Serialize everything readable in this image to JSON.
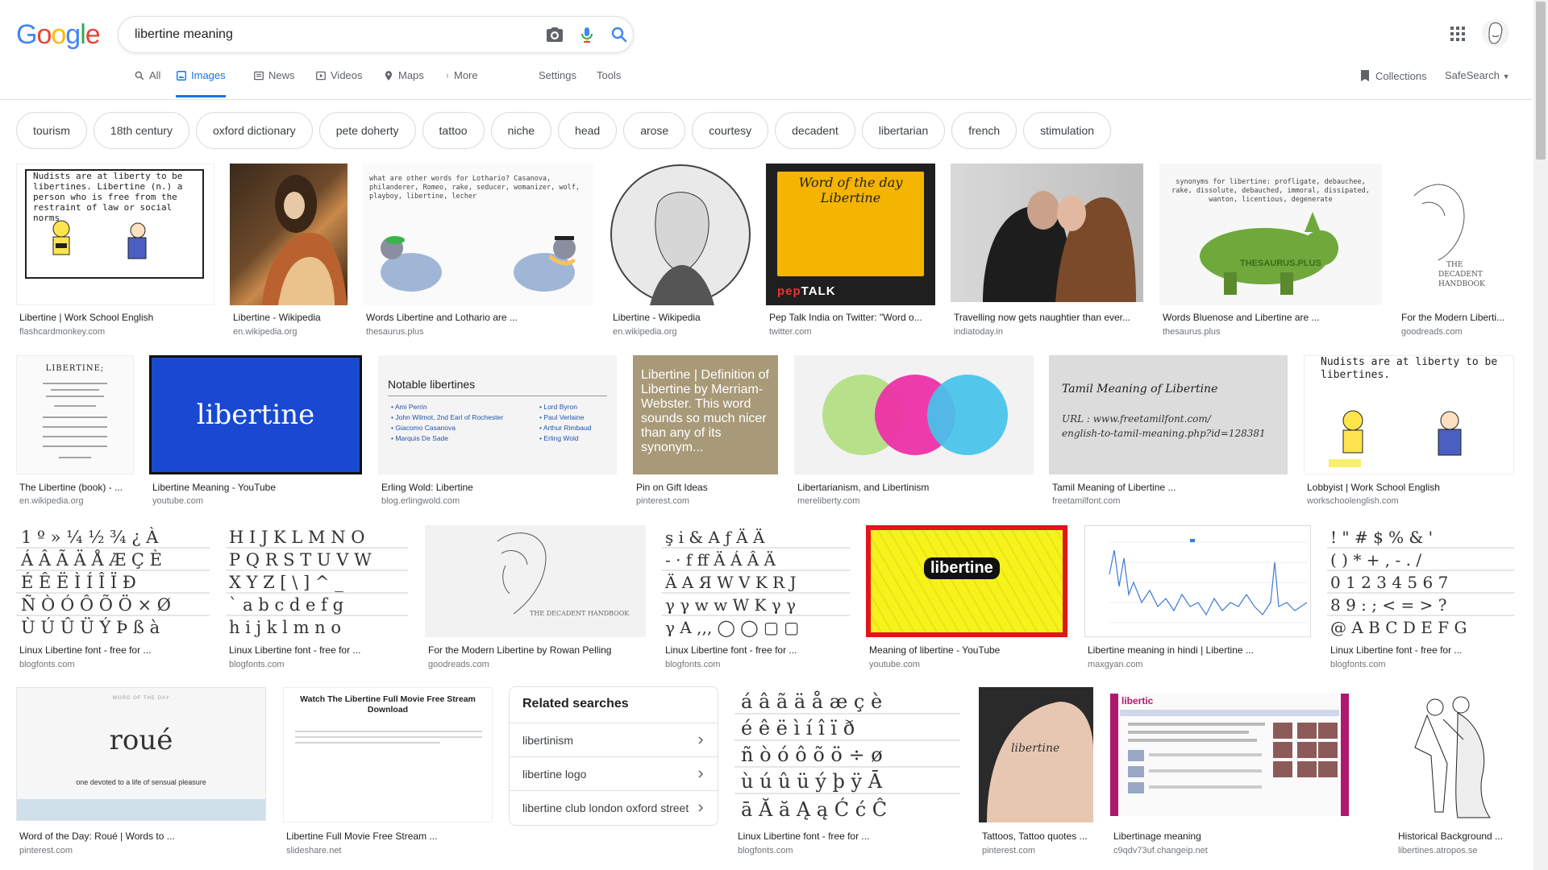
{
  "logo": {
    "letters": [
      "G",
      "o",
      "o",
      "g",
      "l",
      "e"
    ]
  },
  "search": {
    "query": "libertine meaning"
  },
  "nav": {
    "tabs": [
      {
        "label": "All",
        "icon": "search-icon"
      },
      {
        "label": "Images",
        "icon": "image-icon",
        "active": true
      },
      {
        "label": "News",
        "icon": "newspaper-icon"
      },
      {
        "label": "Videos",
        "icon": "play-icon"
      },
      {
        "label": "Maps",
        "icon": "map-icon"
      },
      {
        "label": "More",
        "icon": "more-vert-icon"
      }
    ],
    "settings": "Settings",
    "tools": "Tools",
    "collections": "Collections",
    "safesearch": "SafeSearch"
  },
  "chips": [
    "tourism",
    "18th century",
    "oxford dictionary",
    "pete doherty",
    "tattoo",
    "niche",
    "head",
    "arose",
    "courtesy",
    "decadent",
    "libertarian",
    "french",
    "stimulation"
  ],
  "results": {
    "row1": [
      {
        "caption": "Libertine | Work School English",
        "source": "flashcardmonkey.com",
        "thumb_text": "Nudists are at liberty to be libertines. Libertine (n.) a person who is free from the restraint of law or social norms"
      },
      {
        "caption": "Libertine - Wikipedia",
        "source": "en.wikipedia.org"
      },
      {
        "caption": "Words Libertine and Lothario are ...",
        "source": "thesaurus.plus",
        "thumb_text": "what are other words for Lothario? Casanova, philanderer, Romeo, rake, seducer, womanizer, wolf, playboy, libertine, lecher"
      },
      {
        "caption": "Libertine - Wikipedia",
        "source": "en.wikipedia.org"
      },
      {
        "caption": "Pep Talk India on Twitter: \"Word o...",
        "source": "twitter.com",
        "thumb_text": "Word of the day Libertine"
      },
      {
        "caption": "Travelling now gets naughtier than ever...",
        "source": "indiatoday.in"
      },
      {
        "caption": "Words Bluenose and Libertine are ...",
        "source": "thesaurus.plus",
        "thumb_text": "synonyms for libertine: profligate, debauchee, rake, dissolute, debauched, immoral, dissipated, wanton, licentious, degenerate"
      },
      {
        "caption": "For the Modern Liberti...",
        "source": "goodreads.com"
      }
    ],
    "row2": [
      {
        "caption": "The Libertine (book) - ...",
        "source": "en.wikipedia.org",
        "thumb_text": "LIBERTINE;"
      },
      {
        "caption": "Libertine Meaning - YouTube",
        "source": "youtube.com",
        "thumb_text": "libertine"
      },
      {
        "caption": "Erling Wold: Libertine",
        "source": "blog.erlingwold.com",
        "thumb_text": "Notable libertines",
        "list_left": [
          "Ami Perrin",
          "John Wilmot, 2nd Earl of Rochester",
          "Giacomo Casanova",
          "Marquis De Sade"
        ],
        "list_right": [
          "Lord Byron",
          "Paul Verlaine",
          "Arthur Rimbaud",
          "Erling Wold"
        ]
      },
      {
        "caption": "Pin on Gift Ideas",
        "source": "pinterest.com",
        "thumb_text": "Libertine | Definition of Libertine by Merriam-Webster. This word sounds so much nicer than any of its synonym..."
      },
      {
        "caption": "Libertarianism, and Libertinism",
        "source": "mereliberty.com"
      },
      {
        "caption": "Tamil Meaning of Libertine ...",
        "source": "freetamilfont.com",
        "thumb_text": "Tamil Meaning of Libertine"
      },
      {
        "caption": "Lobbyist | Work School English",
        "source": "workschoolenglish.com",
        "thumb_text": "Nudists are at liberty to be libertines."
      }
    ],
    "row3": [
      {
        "caption": "Linux Libertine font - free for ...",
        "source": "blogfonts.com"
      },
      {
        "caption": "Linux Libertine font - free for ...",
        "source": "blogfonts.com"
      },
      {
        "caption": "For the Modern Libertine by Rowan Pelling",
        "source": "goodreads.com",
        "thumb_text": "THE DECADENT HANDBOOK"
      },
      {
        "caption": "Linux Libertine font - free for ...",
        "source": "blogfonts.com"
      },
      {
        "caption": "Meaning of libertine - YouTube",
        "source": "youtube.com",
        "thumb_text": "libertine"
      },
      {
        "caption": "Libertine meaning in hindi | Libertine ...",
        "source": "maxgyan.com"
      },
      {
        "caption": "Linux Libertine font - free for ...",
        "source": "blogfonts.com"
      }
    ],
    "row4": [
      {
        "caption": "Word of the Day: Roué | Words to ...",
        "source": "pinterest.com",
        "thumb_text": "roué",
        "thumb_sub": "one devoted to a life of sensual pleasure"
      },
      {
        "caption": "Libertine Full Movie Free Stream ...",
        "source": "slideshare.net",
        "thumb_text": "Watch The Libertine Full Movie Free Stream Download"
      },
      {
        "caption": "Linux Libertine font - free for ...",
        "source": "blogfonts.com"
      },
      {
        "caption": "Tattoos, Tattoo quotes ...",
        "source": "pinterest.com"
      },
      {
        "caption": "Libertinage meaning",
        "source": "c9qdv73uf.changeip.net"
      },
      {
        "caption": "Historical Background ...",
        "source": "libertines.atropos.se"
      }
    ]
  },
  "related": {
    "title": "Related searches",
    "items": [
      "libertinism",
      "libertine logo",
      "libertine club london oxford street"
    ]
  },
  "colors": {
    "accent": "#1a73e8",
    "blue": "#4285f4",
    "red": "#ea4335",
    "yellow": "#fbbc05",
    "green": "#34a853"
  }
}
